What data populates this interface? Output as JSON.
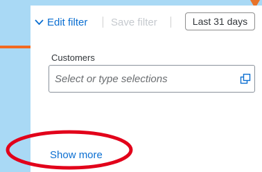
{
  "filter_bar": {
    "edit_filter_label": "Edit filter",
    "save_filter_label": "Save filter",
    "date_range_label": "Last 31 days"
  },
  "customers": {
    "label": "Customers",
    "placeholder": "Select or type selections"
  },
  "show_more_label": "Show more",
  "icons": {
    "edit_filter": "chevron-down-icon",
    "value_help": "value-help-icon"
  },
  "colors": {
    "background": "#a9d9f5",
    "link": "#0a6ed1",
    "annotation": "#e2001a",
    "accent": "#f26a21"
  }
}
